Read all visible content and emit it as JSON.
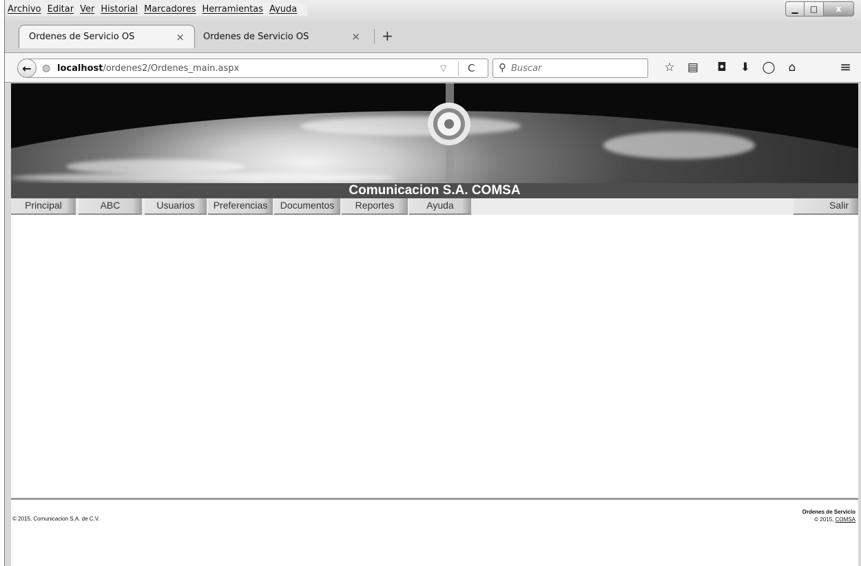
{
  "menubar": {
    "items": [
      "Archivo",
      "Editar",
      "Ver",
      "Historial",
      "Marcadores",
      "Herramientas",
      "Ayuda"
    ]
  },
  "window_controls": {
    "minimize": "▁",
    "maximize": "□",
    "close": "x"
  },
  "tabs": [
    {
      "label": "Ordenes de Servicio OS",
      "close": "×"
    },
    {
      "label": "Ordenes de Servicio OS",
      "close": "×"
    }
  ],
  "new_tab": "+",
  "navigation": {
    "back": "←",
    "globe": "◍",
    "url_host": "localhost",
    "url_path": "/ordenes2/Ordenes_main.aspx",
    "dropdown": "▽",
    "reload": "C",
    "search_icon": "⚲",
    "search_placeholder": "Buscar",
    "toolbar_icons": [
      "☆",
      "▤",
      "◘",
      "⬇",
      "◯",
      "⌂"
    ],
    "menu": "≡"
  },
  "header": {
    "title": "Comunicacion S.A. COMSA"
  },
  "nav_menu": {
    "items": [
      "Principal",
      "ABC",
      "Usuarios",
      "Preferencias",
      "Documentos",
      "Reportes",
      "Ayuda"
    ],
    "exit": "Salir"
  },
  "footer": {
    "copyright_left": "© 2015, Comunicacion S.A. de C.V.",
    "right_title": "Ordenes de Servicio",
    "right_copyright_prefix": "© 2015, ",
    "right_link": "COMSA"
  }
}
